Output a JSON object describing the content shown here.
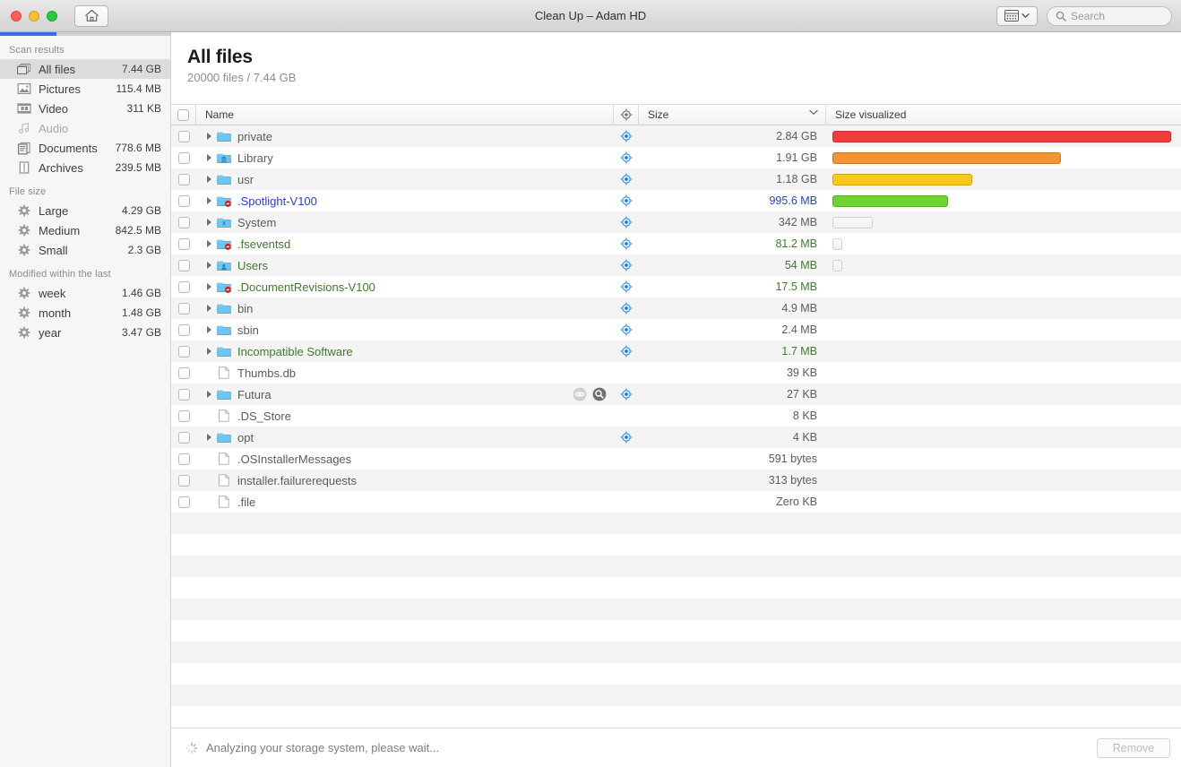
{
  "window": {
    "title": "Clean Up – Adam HD",
    "home_button": "home-icon",
    "traffic_lights": [
      "close",
      "minimize",
      "zoom"
    ],
    "view_button": "view-options-icon",
    "search": {
      "placeholder": "Search",
      "value": ""
    }
  },
  "sidebar": {
    "scan_progress_percent": 33,
    "groups": [
      {
        "title": "Scan results",
        "items": [
          {
            "label": "All files",
            "size": "7.44 GB",
            "icon": "all-files-icon",
            "selected": true,
            "dim": false
          },
          {
            "label": "Pictures",
            "size": "115.4 MB",
            "icon": "pictures-icon",
            "selected": false,
            "dim": false
          },
          {
            "label": "Video",
            "size": "311 KB",
            "icon": "video-icon",
            "selected": false,
            "dim": false
          },
          {
            "label": "Audio",
            "size": "",
            "icon": "audio-icon",
            "selected": false,
            "dim": true
          },
          {
            "label": "Documents",
            "size": "778.6 MB",
            "icon": "documents-icon",
            "selected": false,
            "dim": false
          },
          {
            "label": "Archives",
            "size": "239.5 MB",
            "icon": "archives-icon",
            "selected": false,
            "dim": false
          }
        ]
      },
      {
        "title": "File size",
        "items": [
          {
            "label": "Large",
            "size": "4.29 GB",
            "icon": "gear-icon",
            "selected": false,
            "dim": false
          },
          {
            "label": "Medium",
            "size": "842.5 MB",
            "icon": "gear-icon",
            "selected": false,
            "dim": false
          },
          {
            "label": "Small",
            "size": "2.3 GB",
            "icon": "gear-icon",
            "selected": false,
            "dim": false
          }
        ]
      },
      {
        "title": "Modified within the last",
        "items": [
          {
            "label": "week",
            "size": "1.46 GB",
            "icon": "gear-icon",
            "selected": false,
            "dim": false
          },
          {
            "label": "month",
            "size": "1.48 GB",
            "icon": "gear-icon",
            "selected": false,
            "dim": false
          },
          {
            "label": "year",
            "size": "3.47 GB",
            "icon": "gear-icon",
            "selected": false,
            "dim": false
          }
        ]
      }
    ]
  },
  "main": {
    "title": "All files",
    "subtitle": "20000 files / 7.44 GB",
    "columns": {
      "check": "",
      "name": "Name",
      "target": "target-icon",
      "size": "Size",
      "size_visualized": "Size visualized"
    },
    "sort_indicator": "chevron-down-icon",
    "colors": {
      "neutral_text": "#5b5b5b",
      "blue_text": "#2a3fd0",
      "green_text": "#3f7a2e",
      "bar_red": "#f23b3b",
      "bar_orange": "#f59331",
      "bar_yellow": "#fbc81c",
      "bar_green": "#6cd42c",
      "bar_empty": "#f2f2f2",
      "accent_blue": "#3b6ce8"
    },
    "rows": [
      {
        "name": "private",
        "size": "2.84 GB",
        "icon": "folder-icon",
        "color": "neutral",
        "expandable": true,
        "target": true,
        "bar_width_pct": 98.7,
        "bar_color": "bar_red",
        "hover_icons": []
      },
      {
        "name": "Library",
        "size": "1.91 GB",
        "icon": "folder-library-icon",
        "color": "neutral",
        "expandable": true,
        "target": true,
        "bar_width_pct": 66.7,
        "bar_color": "bar_orange",
        "hover_icons": []
      },
      {
        "name": "usr",
        "size": "1.18 GB",
        "icon": "folder-icon",
        "color": "neutral",
        "expandable": true,
        "target": true,
        "bar_width_pct": 40.8,
        "bar_color": "bar_yellow",
        "hover_icons": []
      },
      {
        "name": ".Spotlight-V100",
        "size": "995.6 MB",
        "icon": "folder-locked-icon",
        "color": "blue",
        "expandable": true,
        "target": true,
        "bar_width_pct": 33.8,
        "bar_color": "bar_green",
        "hover_icons": []
      },
      {
        "name": "System",
        "size": "342 MB",
        "icon": "folder-system-icon",
        "color": "neutral",
        "expandable": true,
        "target": true,
        "bar_width_pct": 11.8,
        "bar_color": "bar_empty",
        "hover_icons": []
      },
      {
        "name": ".fseventsd",
        "size": "81.2 MB",
        "icon": "folder-locked-icon",
        "color": "green",
        "expandable": true,
        "target": true,
        "bar_width_pct": 2.8,
        "bar_color": "bar_empty",
        "hover_icons": []
      },
      {
        "name": "Users",
        "size": "54 MB",
        "icon": "folder-users-icon",
        "color": "green",
        "expandable": true,
        "target": true,
        "bar_width_pct": 2.8,
        "bar_color": "bar_empty",
        "hover_icons": []
      },
      {
        "name": ".DocumentRevisions-V100",
        "size": "17.5 MB",
        "icon": "folder-locked-icon",
        "color": "green",
        "expandable": true,
        "target": true,
        "bar_width_pct": 0,
        "bar_color": "bar_empty",
        "hover_icons": []
      },
      {
        "name": "bin",
        "size": "4.9 MB",
        "icon": "folder-icon",
        "color": "neutral",
        "expandable": true,
        "target": true,
        "bar_width_pct": 0,
        "bar_color": "bar_empty",
        "hover_icons": []
      },
      {
        "name": "sbin",
        "size": "2.4 MB",
        "icon": "folder-icon",
        "color": "neutral",
        "expandable": true,
        "target": true,
        "bar_width_pct": 0,
        "bar_color": "bar_empty",
        "hover_icons": []
      },
      {
        "name": "Incompatible Software",
        "size": "1.7 MB",
        "icon": "folder-icon",
        "color": "green",
        "expandable": true,
        "target": true,
        "bar_width_pct": 0,
        "bar_color": "bar_empty",
        "hover_icons": []
      },
      {
        "name": "Thumbs.db",
        "size": "39 KB",
        "icon": "file-icon",
        "color": "neutral",
        "expandable": false,
        "target": false,
        "bar_width_pct": 0,
        "bar_color": "bar_empty",
        "hover_icons": []
      },
      {
        "name": "Futura",
        "size": "27 KB",
        "icon": "folder-icon",
        "color": "neutral",
        "expandable": true,
        "target": true,
        "bar_width_pct": 0,
        "bar_color": "bar_empty",
        "hover_icons": [
          "preview-eye-icon",
          "reveal-in-finder-icon"
        ]
      },
      {
        "name": ".DS_Store",
        "size": "8 KB",
        "icon": "file-icon",
        "color": "neutral",
        "expandable": false,
        "target": false,
        "bar_width_pct": 0,
        "bar_color": "bar_empty",
        "hover_icons": []
      },
      {
        "name": "opt",
        "size": "4 KB",
        "icon": "folder-icon",
        "color": "neutral",
        "expandable": true,
        "target": true,
        "bar_width_pct": 0,
        "bar_color": "bar_empty",
        "hover_icons": []
      },
      {
        "name": ".OSInstallerMessages",
        "size": "591 bytes",
        "icon": "file-icon",
        "color": "neutral",
        "expandable": false,
        "target": false,
        "bar_width_pct": 0,
        "bar_color": "bar_empty",
        "hover_icons": []
      },
      {
        "name": "installer.failurerequests",
        "size": "313 bytes",
        "icon": "file-icon",
        "color": "neutral",
        "expandable": false,
        "target": false,
        "bar_width_pct": 0,
        "bar_color": "bar_empty",
        "hover_icons": []
      },
      {
        "name": ".file",
        "size": "Zero KB",
        "icon": "file-icon",
        "color": "neutral",
        "expandable": false,
        "target": false,
        "bar_width_pct": 0,
        "bar_color": "bar_empty",
        "hover_icons": []
      }
    ],
    "empty_row_count": 11
  },
  "footer": {
    "status": "Analyzing your storage system, please wait...",
    "spinner": "loading-spinner-icon",
    "remove_label": "Remove",
    "remove_enabled": false
  }
}
